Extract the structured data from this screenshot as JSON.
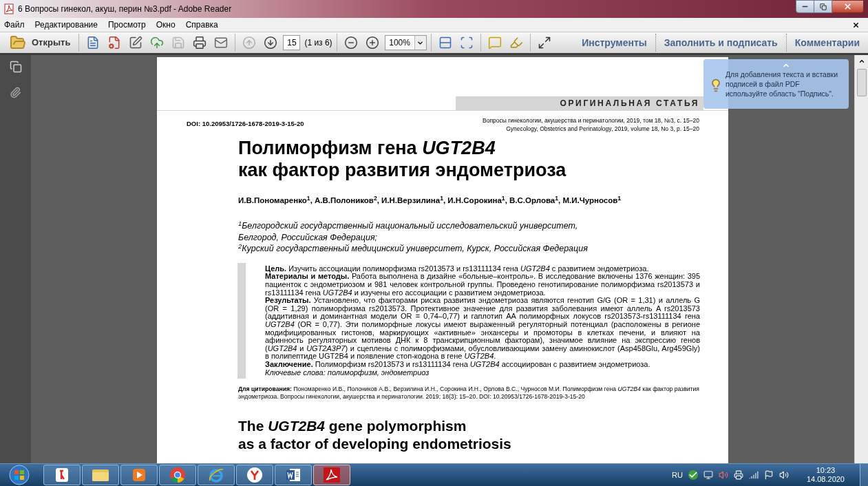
{
  "window": {
    "title": "6 Вопросы гинекол, акуш, перин №3.pdf - Adobe Reader"
  },
  "menu": [
    "Файл",
    "Редактирование",
    "Просмотр",
    "Окно",
    "Справка"
  ],
  "toolbar": {
    "open_label": "Открыть",
    "file_tools": [
      {
        "kind": "create",
        "disabled": false
      },
      {
        "kind": "export",
        "disabled": false
      },
      {
        "kind": "edit",
        "disabled": false
      },
      {
        "kind": "upload",
        "disabled": false
      },
      {
        "kind": "save",
        "disabled": true
      },
      {
        "kind": "print",
        "disabled": false
      },
      {
        "kind": "email",
        "disabled": false
      }
    ],
    "nav_tools": [
      {
        "kind": "previous",
        "disabled": true
      },
      {
        "kind": "next",
        "disabled": false
      }
    ],
    "page_number": "15",
    "page_count": "(1 из 6)",
    "zoom_tools": [
      {
        "kind": "zoom_out",
        "disabled": false
      },
      {
        "kind": "zoom_in",
        "disabled": false
      }
    ],
    "zoom": "100%",
    "view_tools": [
      {
        "kind": "scroll",
        "disabled": false
      },
      {
        "kind": "fit",
        "disabled": false
      }
    ],
    "comment_tools": [
      {
        "kind": "comment",
        "disabled": false
      },
      {
        "kind": "highlight",
        "disabled": false
      }
    ],
    "mode_tools": [
      {
        "kind": "fullscreen",
        "disabled": false
      }
    ],
    "panels": [
      "Инструменты",
      "Заполнить и подписать",
      "Комментарии"
    ]
  },
  "tooltip": {
    "text": "Для добавления текста и вставки подписей в файл PDF используйте область \"Подпись\"."
  },
  "document": {
    "section": "ОРИГИНАЛЬНАЯ СТАТЬЯ",
    "doi": "DOI: 10.20953/1726-1678-2019-3-15-20",
    "journal": [
      "Вопросы гинекологии, акушерства и перинатологии, 2019, том 18, №3, с. 15–20",
      "Gynecology, Obstetrics and Perinatology, 2019, volume 18, No 3, p. 15–20"
    ],
    "title": [
      "Полиморфизм гена *UGT2B4*",
      "как фактор развития эндометриоза"
    ],
    "authors": "И.В.Пономаренко$^{1}$, А.В.Полоников$^{2}$, И.Н.Верзилина$^{1}$, И.Н.Сорокина$^{1}$, В.С.Орлова$^{1}$, М.И.Чурносов$^{1}$",
    "affiliations": [
      "$^{1}$Белгородский государственный национальный исследовательский университет,",
      "Белгород, Российская Федерация;",
      "$^{2}$Курский государственный медицинский университет, Курск, Российская Федерация"
    ],
    "abstract": [
      "**Цель.** Изучить ассоциации полиморфизма rs2013573 и rs13111134 гена *UGT2B4* с развитием эндометриоза.",
      "**Материалы и методы.** Работа выполнена в дизайне «больные–контроль». В исследование включены 1376 женщин: 395 пациенток с эндометриозом и 981 человек контрольной группы. Проведено генотипирование полиморфизма rs2013573 и rs13111134 гена *UGT2B4* и изучены его ассоциации с развитием эндометриоза.",
      "**Результаты.** Установлено, что факторами риска развития эндометриоза являются генотип G/G (OR = 1,31) и аллель G (OR = 1,29) полиморфизма rs2013573. Протективное значение для развития заболевания имеют аллель A rs2013573 (аддитивная и доминантная модели OR = 0,74–0,77) и гаплотип AA полиморфных локусов rs2013573-rs13111134 гена *UGT2B4* (OR = 0,77). Эти полиморфные локусы имеют выраженный регуляторный потенциал (расположены в регионе модифицированных гистонов, маркирующих «активные» энхансеры и промоторы в клетках печени, и влияют на афинность регуляторных мотивов ДНК к 8 транскрипционным факторам), значимое влияние на экспрессию генов (*UGT2B4* и *UGT2A3P7*) и сцеплены с полиморфизмами, обусловливающими замену аминокислот (Asp458Glu, Arg459Gly) в полипептиде UGT2B4 и появление стоп-кодона в гене *UGT2B4*.",
      "**Заключение.** Полиморфизм rs2013573 и rs13111134 гена *UGT2B4* ассоциирован с развитием эндометриоза."
    ],
    "keywords": "Ключевые слова: полиморфизм, эндометриоз",
    "citation": "**Для цитирования:** Пономаренко И.В., Полоников А.В., Верзилина И.Н., Сорокина И.Н., Орлова В.С., Чурносов М.И. Полиморфизм гена *UGT2B4* как фактор развития эндометриоза. Вопросы гинекологии, акушерства и перинатологии. 2019; 18(3): 15–20. DOI: 10.20953/1726-1678-2019-3-15-20",
    "title_en": [
      "The *UGT2B4* gene polymorphism",
      "as a factor of developing endometriosis"
    ]
  },
  "taskbar": {
    "apps": [
      {
        "kind": "yandex",
        "selected": false
      },
      {
        "kind": "folder",
        "selected": false
      },
      {
        "kind": "player",
        "selected": false
      },
      {
        "kind": "chrome",
        "selected": false
      },
      {
        "kind": "ie",
        "selected": false
      },
      {
        "kind": "browser",
        "selected": false
      },
      {
        "kind": "word",
        "selected": false
      },
      {
        "kind": "acrobat",
        "selected": true
      }
    ],
    "language": "RU",
    "time": "10:23",
    "date": "14.08.2020"
  }
}
